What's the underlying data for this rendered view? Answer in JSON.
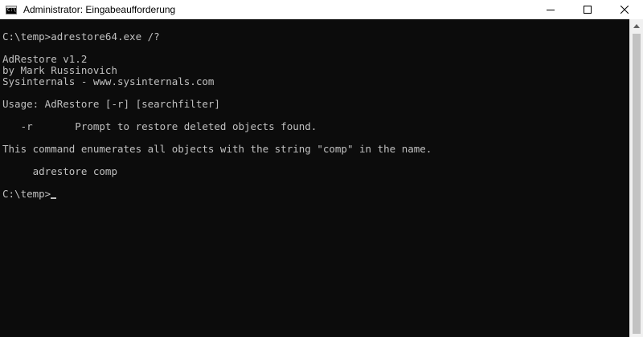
{
  "window": {
    "title": "Administrator: Eingabeaufforderung"
  },
  "console": {
    "lines": [
      "C:\\temp>adrestore64.exe /?",
      "",
      "AdRestore v1.2",
      "by Mark Russinovich",
      "Sysinternals - www.sysinternals.com",
      "",
      "Usage: AdRestore [-r] [searchfilter]",
      "",
      "   -r       Prompt to restore deleted objects found.",
      "",
      "This command enumerates all objects with the string \"comp\" in the name.",
      "",
      "     adrestore comp",
      "",
      "C:\\temp>"
    ]
  },
  "icons": {
    "app": "console-icon",
    "minimize": "minimize-icon",
    "maximize": "maximize-icon",
    "close": "close-icon",
    "scroll_up": "arrow-up-icon"
  },
  "colors": {
    "console_background": "#0c0c0c",
    "console_text": "#c0c0c0",
    "titlebar_background": "#ffffff"
  }
}
